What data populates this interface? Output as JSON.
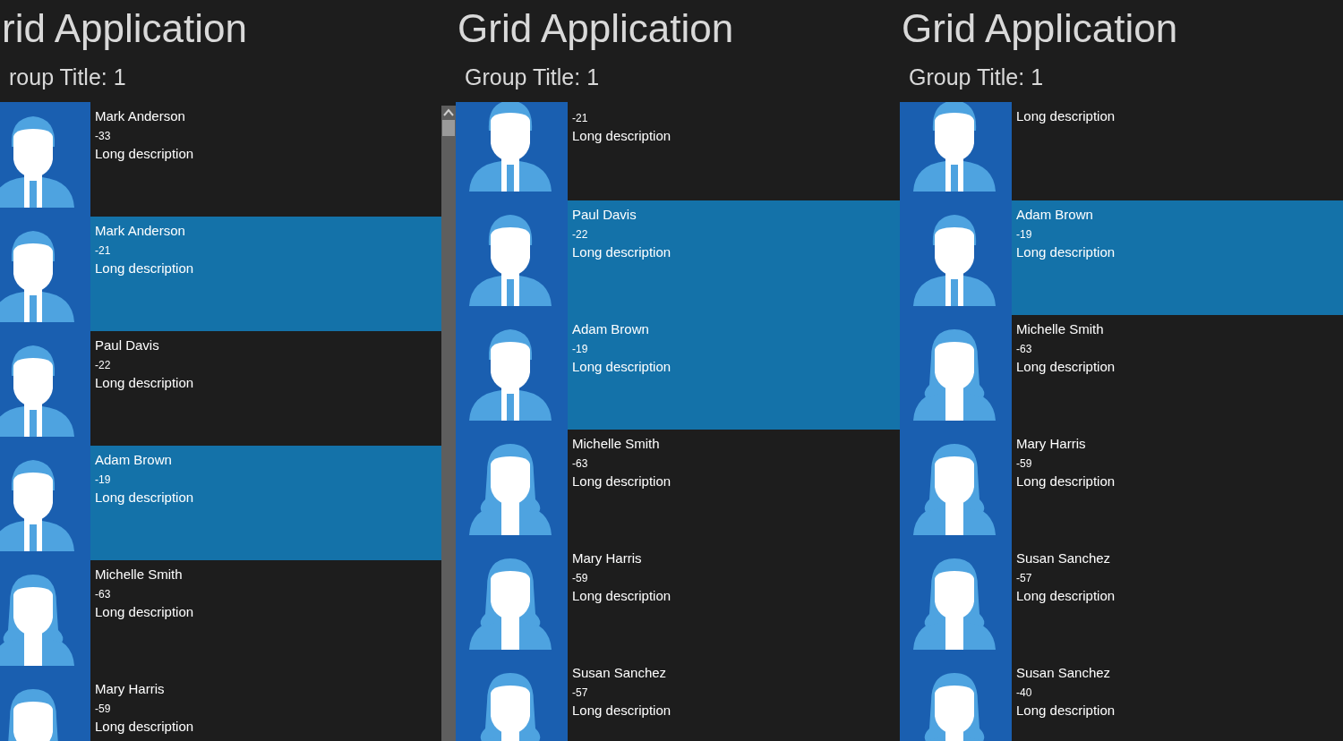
{
  "panels": [
    {
      "title": "rid Application",
      "group_title": "roup Title: 1",
      "items": [
        {
          "kind": "male",
          "name": "Mark Anderson",
          "value": "-33",
          "description": "Long description",
          "selected": false
        },
        {
          "kind": "male",
          "name": "Mark Anderson",
          "value": "-21",
          "description": "Long description",
          "selected": true
        },
        {
          "kind": "male",
          "name": "Paul Davis",
          "value": "-22",
          "description": "Long description",
          "selected": false
        },
        {
          "kind": "male",
          "name": "Adam Brown",
          "value": "-19",
          "description": "Long description",
          "selected": true
        },
        {
          "kind": "female",
          "name": "Michelle Smith",
          "value": "-63",
          "description": "Long description",
          "selected": false
        },
        {
          "kind": "female",
          "name": "Mary Harris",
          "value": "-59",
          "description": "Long description",
          "selected": false
        }
      ]
    },
    {
      "title": "Grid Application",
      "group_title": "Group Title: 1",
      "items": [
        {
          "kind": "male",
          "value": "-21",
          "description": "Long description",
          "selected": false
        },
        {
          "kind": "male",
          "name": "Paul Davis",
          "value": "-22",
          "description": "Long description",
          "selected": true
        },
        {
          "kind": "male",
          "name": "Adam Brown",
          "value": "-19",
          "description": "Long description",
          "selected": true
        },
        {
          "kind": "female",
          "name": "Michelle Smith",
          "value": "-63",
          "description": "Long description",
          "selected": false
        },
        {
          "kind": "female",
          "name": "Mary Harris",
          "value": "-59",
          "description": "Long description",
          "selected": false
        },
        {
          "kind": "female",
          "name": "Susan Sanchez",
          "value": "-57",
          "description": "Long description",
          "selected": false
        }
      ]
    },
    {
      "title": "Grid Application",
      "group_title": "Group Title: 1",
      "items": [
        {
          "kind": "male",
          "description": "Long description",
          "selected": false
        },
        {
          "kind": "male",
          "name": "Adam Brown",
          "value": "-19",
          "description": "Long description",
          "selected": true
        },
        {
          "kind": "female",
          "name": "Michelle Smith",
          "value": "-63",
          "description": "Long description",
          "selected": false
        },
        {
          "kind": "female",
          "name": "Mary Harris",
          "value": "-59",
          "description": "Long description",
          "selected": false
        },
        {
          "kind": "female",
          "name": "Susan Sanchez",
          "value": "-57",
          "description": "Long description",
          "selected": false
        },
        {
          "kind": "female",
          "name": "Susan Sanchez",
          "value": "-40",
          "description": "Long description",
          "selected": false
        }
      ]
    }
  ]
}
